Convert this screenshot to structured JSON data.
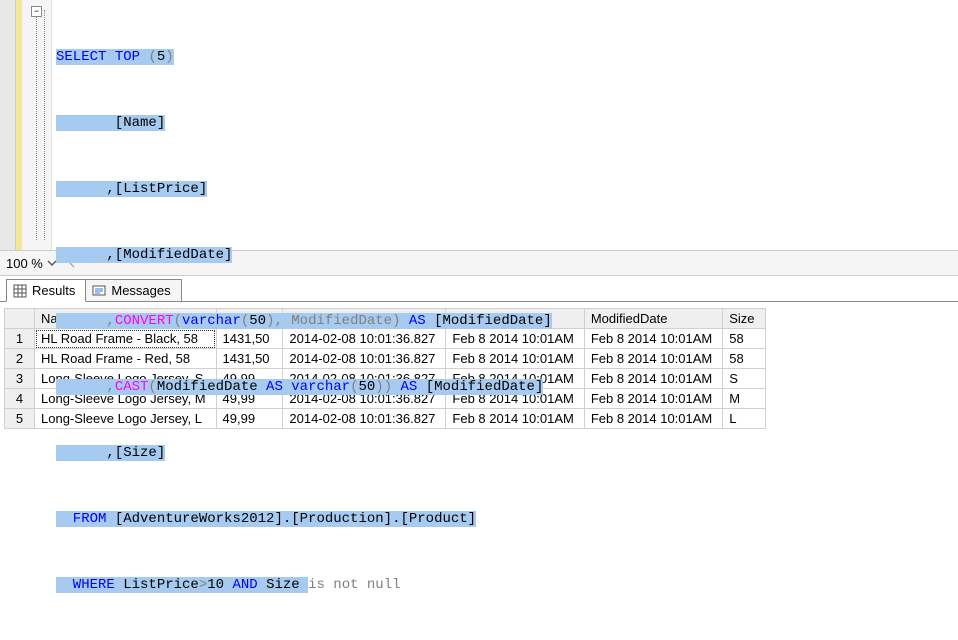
{
  "zoom": {
    "level": "100 %"
  },
  "tabs": {
    "results": "Results",
    "messages": "Messages"
  },
  "sql": {
    "l1a": "SELECT",
    "l1b": " TOP ",
    "l1c": "(",
    "l1d": "5",
    "l1e": ")",
    "l2": "       [Name]",
    "l3": "      ,[ListPrice]",
    "l4": "      ,[ModifiedDate]",
    "l5a": "      ,",
    "l5b": "CONVERT",
    "l5c": "(",
    "l5d": "varchar",
    "l5e": "(",
    "l5f": "50",
    "l5g": "), ModifiedDate) ",
    "l5h": "AS",
    "l5i": " [ModifiedDate]",
    "l6a": "      ,",
    "l6b": "CAST",
    "l6c": "(",
    "l6d": "ModifiedDate ",
    "l6e": "AS",
    "l6f": " varchar",
    "l6g": "(",
    "l6h": "50",
    "l6i": ")) ",
    "l6j": "AS",
    "l6k": " [ModifiedDate]",
    "l7": "      ,[Size]",
    "l8a": "  FROM",
    "l8b": " [AdventureWorks2012].[Production].[Product]",
    "l9a": "  WHERE",
    "l9b": " ListPrice",
    "l9c": ">",
    "l9d": "10 ",
    "l9e": "AND",
    "l9f": " Size ",
    "l9g": "is not null"
  },
  "grid": {
    "headers": [
      "Name",
      "ListPrice",
      "ModifiedDate",
      "ModifiedDate",
      "ModifiedDate",
      "Size"
    ],
    "rows": [
      {
        "n": "1",
        "c": [
          "HL Road Frame - Black, 58",
          "1431,50",
          "2014-02-08 10:01:36.827",
          "Feb  8 2014 10:01AM",
          "Feb  8 2014 10:01AM",
          "58"
        ]
      },
      {
        "n": "2",
        "c": [
          "HL Road Frame - Red, 58",
          "1431,50",
          "2014-02-08 10:01:36.827",
          "Feb  8 2014 10:01AM",
          "Feb  8 2014 10:01AM",
          "58"
        ]
      },
      {
        "n": "3",
        "c": [
          "Long-Sleeve Logo Jersey, S",
          "49,99",
          "2014-02-08 10:01:36.827",
          "Feb  8 2014 10:01AM",
          "Feb  8 2014 10:01AM",
          "S"
        ]
      },
      {
        "n": "4",
        "c": [
          "Long-Sleeve Logo Jersey, M",
          "49,99",
          "2014-02-08 10:01:36.827",
          "Feb  8 2014 10:01AM",
          "Feb  8 2014 10:01AM",
          "M"
        ]
      },
      {
        "n": "5",
        "c": [
          "Long-Sleeve Logo Jersey, L",
          "49,99",
          "2014-02-08 10:01:36.827",
          "Feb  8 2014 10:01AM",
          "Feb  8 2014 10:01AM",
          "L"
        ]
      }
    ]
  }
}
